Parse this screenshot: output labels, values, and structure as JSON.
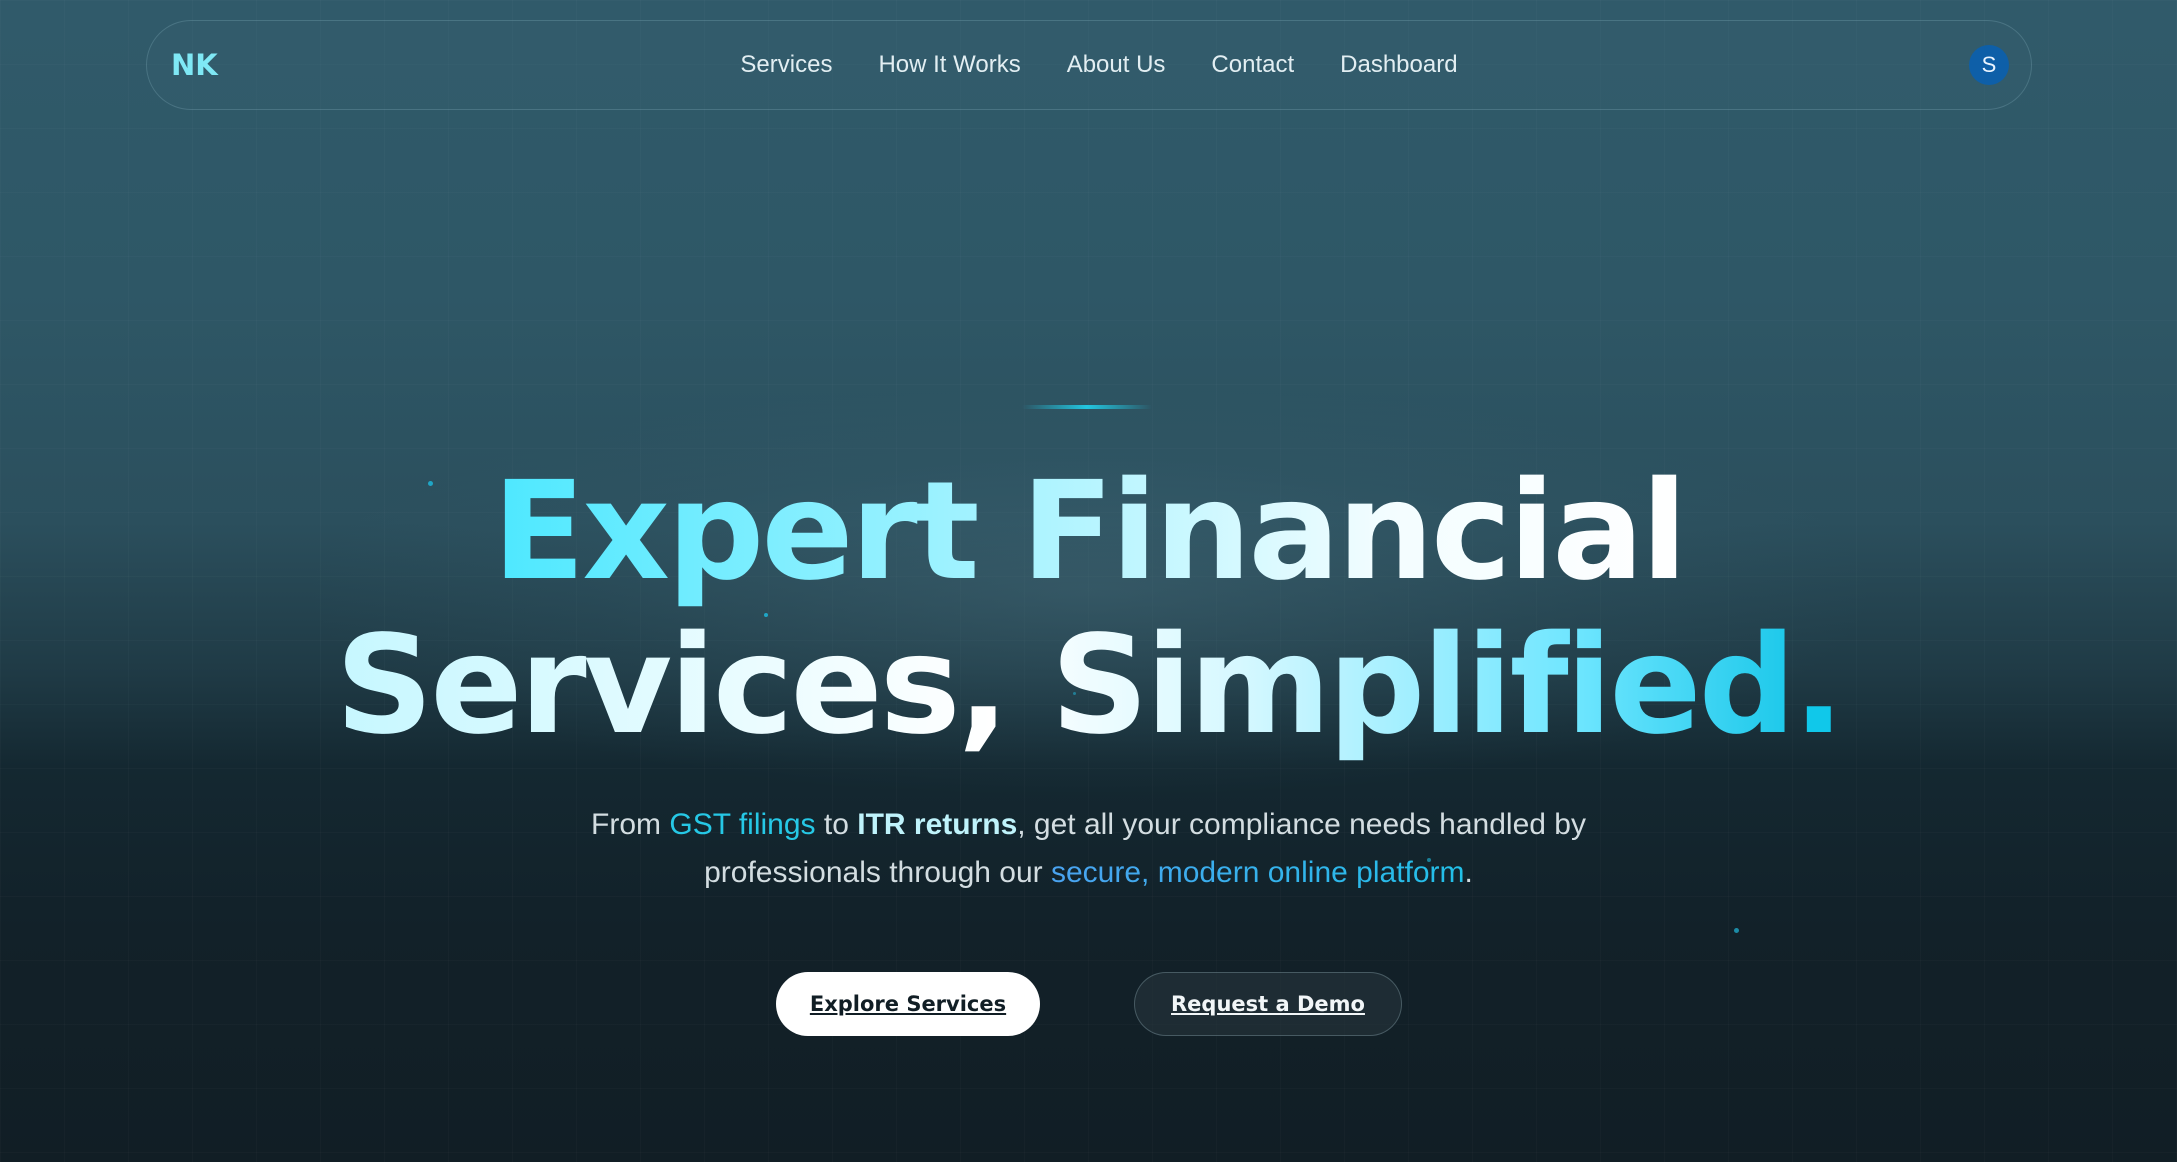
{
  "nav": {
    "logo": "NK",
    "items": [
      "Services",
      "How It Works",
      "About Us",
      "Contact",
      "Dashboard"
    ],
    "avatar_initial": "S"
  },
  "hero": {
    "title_line1": "Expert Financial",
    "title_line2_main": "Services, Simplified",
    "title_line2_dot": ".",
    "subtitle": {
      "p1": "From ",
      "hl1": "GST filings",
      "p2": " to ",
      "hl2": "ITR returns",
      "p3": ", get all your compliance needs handled by",
      "p4": "professionals through our ",
      "hl3": "secure, modern online platform",
      "p5": "."
    },
    "primary_button": "Explore Services",
    "secondary_button": "Request a Demo"
  },
  "colors": {
    "accent": "#10c8ea",
    "avatar_bg": "#0e5fa8",
    "background_top": "#305a6a",
    "background_bottom": "#111e25"
  }
}
